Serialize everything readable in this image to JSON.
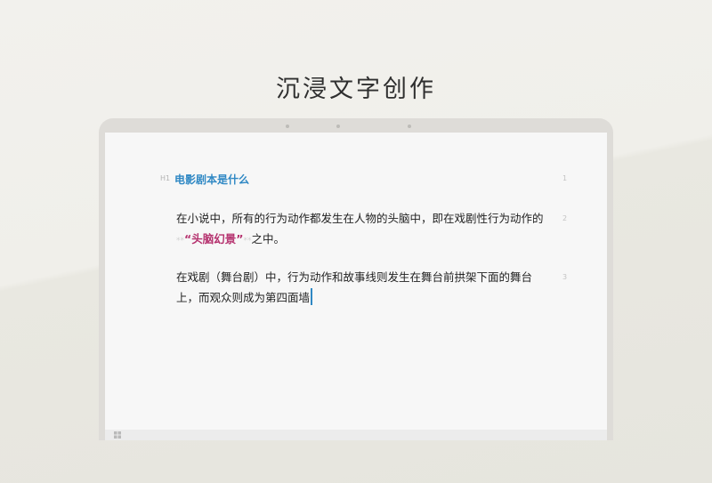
{
  "headline": "沉浸文字创作",
  "editor": {
    "heading_tag": "H1",
    "heading": "电影剧本是什么",
    "line_numbers": [
      "1",
      "2",
      "3"
    ],
    "p1_before": "在小说中，所有的行为动作都发生在人物的头脑中，即在戏剧性行为动作的",
    "p1_mark_open": "**",
    "p1_emph": "“头脑幻景”",
    "p1_mark_close": "**",
    "p1_after": "之中。",
    "p2": "在戏剧（舞台剧）中，行为动作和故事线则发生在舞台前拱架下面的舞台上，而观众则成为第四面墙"
  },
  "colors": {
    "heading": "#2f88c4",
    "emphasis": "#b5316e",
    "caret": "#2f88c4"
  },
  "icons": {
    "taskbar": "windows-icon"
  }
}
